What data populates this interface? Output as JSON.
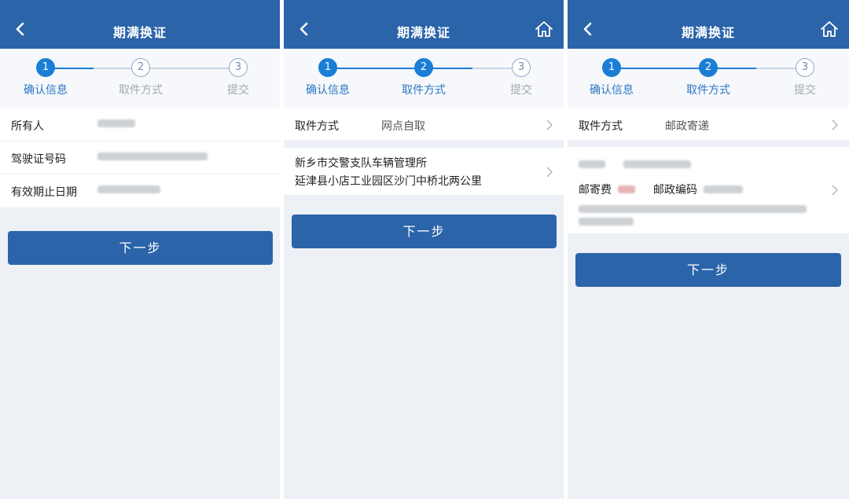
{
  "colors": {
    "brand": "#2b64a9",
    "accent": "#1b7ed6",
    "background": "#edf1f5"
  },
  "screens": [
    {
      "title": "期满换证",
      "steps": [
        {
          "num": "1",
          "label": "确认信息",
          "state": "active"
        },
        {
          "num": "2",
          "label": "取件方式",
          "state": "todo"
        },
        {
          "num": "3",
          "label": "提交",
          "state": "todo"
        }
      ],
      "info": [
        {
          "key": "所有人"
        },
        {
          "key": "驾驶证号码"
        },
        {
          "key": "有效期止日期"
        }
      ],
      "next_label": "下一步"
    },
    {
      "title": "期满换证",
      "home_icon": "home-icon",
      "steps": [
        {
          "num": "1",
          "label": "确认信息",
          "state": "active"
        },
        {
          "num": "2",
          "label": "取件方式",
          "state": "active"
        },
        {
          "num": "3",
          "label": "提交",
          "state": "todo"
        }
      ],
      "method": {
        "key": "取件方式",
        "value": "网点自取"
      },
      "office": {
        "name": "新乡市交警支队车辆管理所",
        "address": "延津县小店工业园区沙门中桥北两公里"
      },
      "next_label": "下一步"
    },
    {
      "title": "期满换证",
      "home_icon": "home-icon",
      "steps": [
        {
          "num": "1",
          "label": "确认信息",
          "state": "active"
        },
        {
          "num": "2",
          "label": "取件方式",
          "state": "active"
        },
        {
          "num": "3",
          "label": "提交",
          "state": "todo"
        }
      ],
      "method": {
        "key": "取件方式",
        "value": "邮政寄递"
      },
      "postage_label": "邮寄费",
      "postcode_label": "邮政编码",
      "next_label": "下一步"
    }
  ]
}
